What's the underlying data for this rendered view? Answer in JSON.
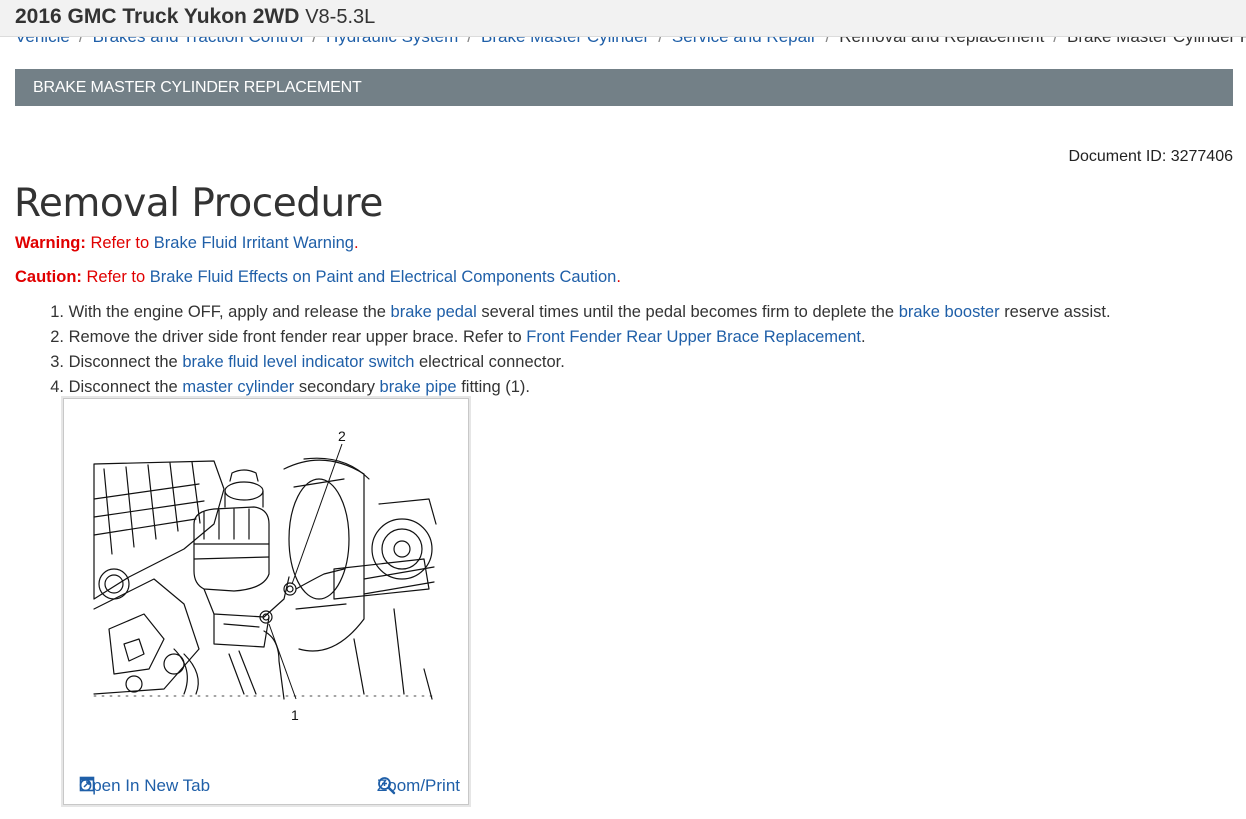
{
  "header": {
    "vehicle": "2016 GMC Truck Yukon 2WD",
    "engine": "V8-5.3L"
  },
  "breadcrumb": [
    "Vehicle",
    "Brakes and Traction Control",
    "Hydraulic System",
    "Brake Master Cylinder",
    "Service and Repair",
    "Removal and Replacement",
    "Brake Master Cylinder Replacement"
  ],
  "section": {
    "title": "BRAKE MASTER CYLINDER REPLACEMENT"
  },
  "document": {
    "id_text": "Document ID: 3277406"
  },
  "procedure": {
    "title": "Removal Procedure",
    "warning": {
      "label": "Warning:",
      "refer": "Refer to",
      "link": "Brake Fluid Irritant Warning",
      "end": "."
    },
    "caution": {
      "label": "Caution:",
      "refer": "Refer to",
      "link": "Brake Fluid Effects on Paint and Electrical Components Caution",
      "end": "."
    },
    "steps": [
      {
        "num": "1.",
        "t1": "With the engine OFF, apply and release the",
        "l1": "brake pedal",
        "t2": "several times until the pedal becomes firm to deplete the",
        "l2": "brake booster",
        "t3": "reserve assist."
      },
      {
        "num": "2.",
        "t1": "Remove the driver side front fender rear upper brace. Refer to",
        "l1": "Front Fender Rear Upper Brace Replacement",
        "t2": "."
      },
      {
        "num": "3.",
        "t1": "Disconnect the",
        "l1": "brake fluid level indicator switch",
        "t2": "electrical connector."
      },
      {
        "num": "4.",
        "t1": "Disconnect the",
        "l1": "master cylinder",
        "t2": "secondary",
        "l2": "brake pipe",
        "t3": "fitting (1)."
      }
    ]
  },
  "figure": {
    "callouts": [
      "1",
      "2"
    ],
    "open_tab_label": "Open In New Tab",
    "zoom_print_label": "Zoom/Print"
  },
  "colors": {
    "link": "#1f5fa8",
    "alert": "#e00000",
    "section_bar": "#738087"
  }
}
